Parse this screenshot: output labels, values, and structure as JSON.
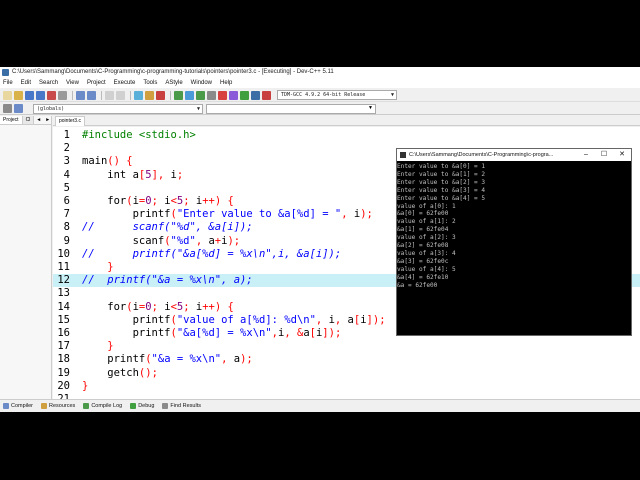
{
  "window": {
    "title": "C:\\Users\\Sammang\\Documents\\C-Programming\\c-programming-tutorials\\pointers\\pointer3.c - [Executing] - Dev-C++ 5.11"
  },
  "menu": [
    "File",
    "Edit",
    "Search",
    "View",
    "Project",
    "Execute",
    "Tools",
    "AStyle",
    "Window",
    "Help"
  ],
  "toolbar": {
    "compiler": "TDM-GCC 4.9.2 64-bit Release",
    "globals": "(globals)"
  },
  "left_panel": {
    "tabs": [
      "Project",
      "Cl"
    ],
    "nav_prev": "◄",
    "nav_next": "►"
  },
  "editor": {
    "file_tab": "pointer3.c",
    "lines": [
      {
        "n": "1",
        "t": "#include <stdio.h>"
      },
      {
        "n": "2",
        "t": ""
      },
      {
        "n": "3",
        "t": "main() {"
      },
      {
        "n": "4",
        "t": "    int a[5], i;"
      },
      {
        "n": "5",
        "t": ""
      },
      {
        "n": "6",
        "t": "    for(i=0; i<5; i++) {"
      },
      {
        "n": "7",
        "t": "        printf(\"Enter value to &a[%d] = \", i);"
      },
      {
        "n": "8",
        "t": "//      scanf(\"%d\", &a[i]);"
      },
      {
        "n": "9",
        "t": "        scanf(\"%d\", a+i);"
      },
      {
        "n": "10",
        "t": "//      printf(\"&a[%d] = %x\\n\",i, &a[i]);"
      },
      {
        "n": "11",
        "t": "    }"
      },
      {
        "n": "12",
        "t": "//  printf(\"&a = %x\\n\", a);"
      },
      {
        "n": "13",
        "t": ""
      },
      {
        "n": "14",
        "t": "    for(i=0; i<5; i++) {"
      },
      {
        "n": "15",
        "t": "        printf(\"value of a[%d]: %d\\n\", i, a[i]);"
      },
      {
        "n": "16",
        "t": "        printf(\"&a[%d] = %x\\n\",i, &a[i]);"
      },
      {
        "n": "17",
        "t": "    }"
      },
      {
        "n": "18",
        "t": "    printf(\"&a = %x\\n\", a);"
      },
      {
        "n": "19",
        "t": "    getch();"
      },
      {
        "n": "20",
        "t": "}"
      },
      {
        "n": "21",
        "t": ""
      }
    ],
    "highlighted_line": "12"
  },
  "bottom_tabs": [
    "Compiler",
    "Resources",
    "Compile Log",
    "Debug",
    "Find Results"
  ],
  "console": {
    "title": "C:\\Users\\Sammang\\Documents\\C-Programming\\c-progra...",
    "controls": [
      "–",
      "☐",
      "✕"
    ],
    "output": [
      "Enter value to &a[0] = 1",
      "Enter value to &a[1] = 2",
      "Enter value to &a[2] = 3",
      "Enter value to &a[3] = 4",
      "Enter value to &a[4] = 5",
      "value of a[0]: 1",
      "&a[0] = 62fe00",
      "value of a[1]: 2",
      "&a[1] = 62fe04",
      "value of a[2]: 3",
      "&a[2] = 62fe08",
      "value of a[3]: 4",
      "&a[3] = 62fe0c",
      "value of a[4]: 5",
      "&a[4] = 62fe10",
      "&a = 62fe00"
    ]
  }
}
